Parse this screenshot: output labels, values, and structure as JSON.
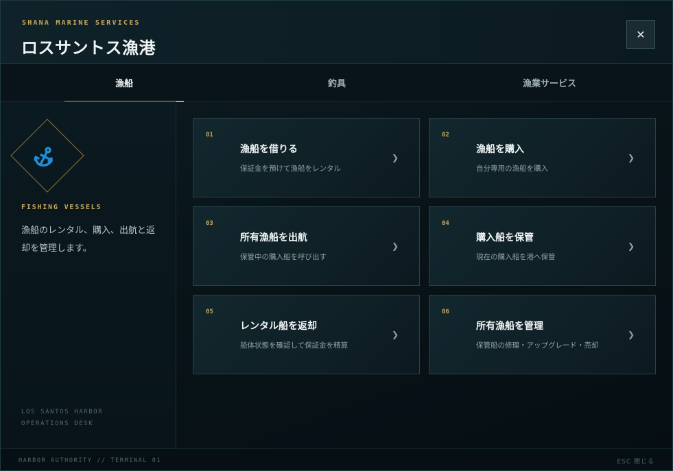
{
  "header": {
    "brand": "SHANA MARINE SERVICES",
    "title": "ロスサントス漁港",
    "close_label": "✕"
  },
  "tabs": [
    {
      "label": "漁船",
      "active": true
    },
    {
      "label": "釣具",
      "active": false
    },
    {
      "label": "漁業サービス",
      "active": false
    }
  ],
  "sidebar": {
    "icon": "anchor-icon",
    "label": "FISHING VESSELS",
    "description": "漁船のレンタル、購入、出航と返却を管理します。",
    "footer_line1": "LOS SANTOS HARBOR",
    "footer_line2": "OPERATIONS DESK"
  },
  "cards": [
    {
      "num": "01",
      "title": "漁船を借りる",
      "subtitle": "保証金を預けて漁船をレンタル",
      "chevron": "❯"
    },
    {
      "num": "02",
      "title": "漁船を購入",
      "subtitle": "自分専用の漁船を購入",
      "chevron": "❯"
    },
    {
      "num": "03",
      "title": "所有漁船を出航",
      "subtitle": "保管中の購入船を呼び出す",
      "chevron": "❯"
    },
    {
      "num": "04",
      "title": "購入船を保管",
      "subtitle": "現在の購入船を港へ保管",
      "chevron": "❯"
    },
    {
      "num": "05",
      "title": "レンタル船を返却",
      "subtitle": "船体状態を確認して保証金を精算",
      "chevron": "❯"
    },
    {
      "num": "06",
      "title": "所有漁船を管理",
      "subtitle": "保管船の修理・アップグレード・売却",
      "chevron": "❯"
    }
  ],
  "footer": {
    "left": "HARBOR AUTHORITY // TERMINAL 01",
    "right": "ESC  閉じる"
  },
  "colors": {
    "accent": "#c9a95f",
    "anchor": "#1e8fd8",
    "background": "#081419"
  }
}
